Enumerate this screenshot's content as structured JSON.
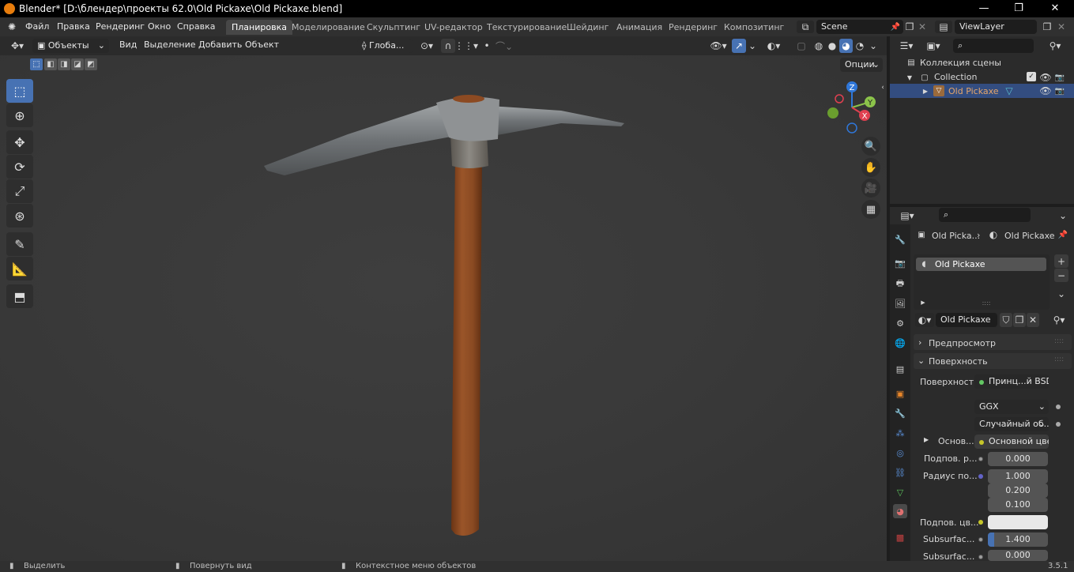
{
  "titlebar": {
    "title": "Blender* [D:\\блендер\\проекты 62.0\\Old Pickaxe\\Old Pickaxe.blend]",
    "minimize": "—",
    "maximize": "❐",
    "close": "✕"
  },
  "menu": {
    "file": "Файл",
    "edit": "Правка",
    "render": "Рендеринг",
    "window": "Окно",
    "help": "Справка"
  },
  "workspaces": [
    "Планировка",
    "Моделирование",
    "Скульптинг",
    "UV-редактор",
    "Текстурирование",
    "Шейдинг",
    "Анимация",
    "Рендеринг",
    "Композитинг"
  ],
  "scene": {
    "name": "Scene",
    "viewlayer": "ViewLayer"
  },
  "viewport_header": {
    "mode": "Объекты",
    "view": "Вид",
    "select": "Выделение",
    "add": "Добавить",
    "object": "Объект",
    "orientation": "Глоба...",
    "options": "Опции"
  },
  "gizmo": {
    "z": "Z",
    "y": "Y",
    "x": "X"
  },
  "outliner": {
    "scene_collection": "Коллекция сцены",
    "collection": "Collection",
    "object": "Old Pickaxe"
  },
  "properties": {
    "breadcrumb_object": "Old Picka...",
    "breadcrumb_material": "Old Pickaxe",
    "slot": "Old Pickaxe",
    "material_name": "Old Pickaxe",
    "preview_panel": "Предпросмотр",
    "surface_panel": "Поверхность",
    "surface_label": "Поверхность",
    "surface_value": "Принц...й BSDF",
    "distribution": "GGX",
    "subsurface_method": "Случайный об...",
    "base_label": "Основ...",
    "base_value": "Основной цвет",
    "subsurface_label": "Подпов. р...",
    "subsurface_value": "0.000",
    "radius_label": "Радиус по...",
    "radius": [
      "1.000",
      "0.200",
      "0.100"
    ],
    "subsurface_color_label": "Подпов. цв...",
    "subsurface_ior_label": "Subsurfac...",
    "subsurface_ior": "1.400",
    "subsurface_aniso_label": "Subsurfac...",
    "subsurface_aniso": "0.000"
  },
  "status": {
    "select": "Выделить",
    "rotate": "Повернуть вид",
    "context": "Контекстное меню объектов",
    "version": "3.5.1"
  },
  "colors": {
    "accent": "#4772b3",
    "handle": "#8b4a22",
    "metal": "#7b7e80",
    "selected_text": "#e6a66a"
  }
}
